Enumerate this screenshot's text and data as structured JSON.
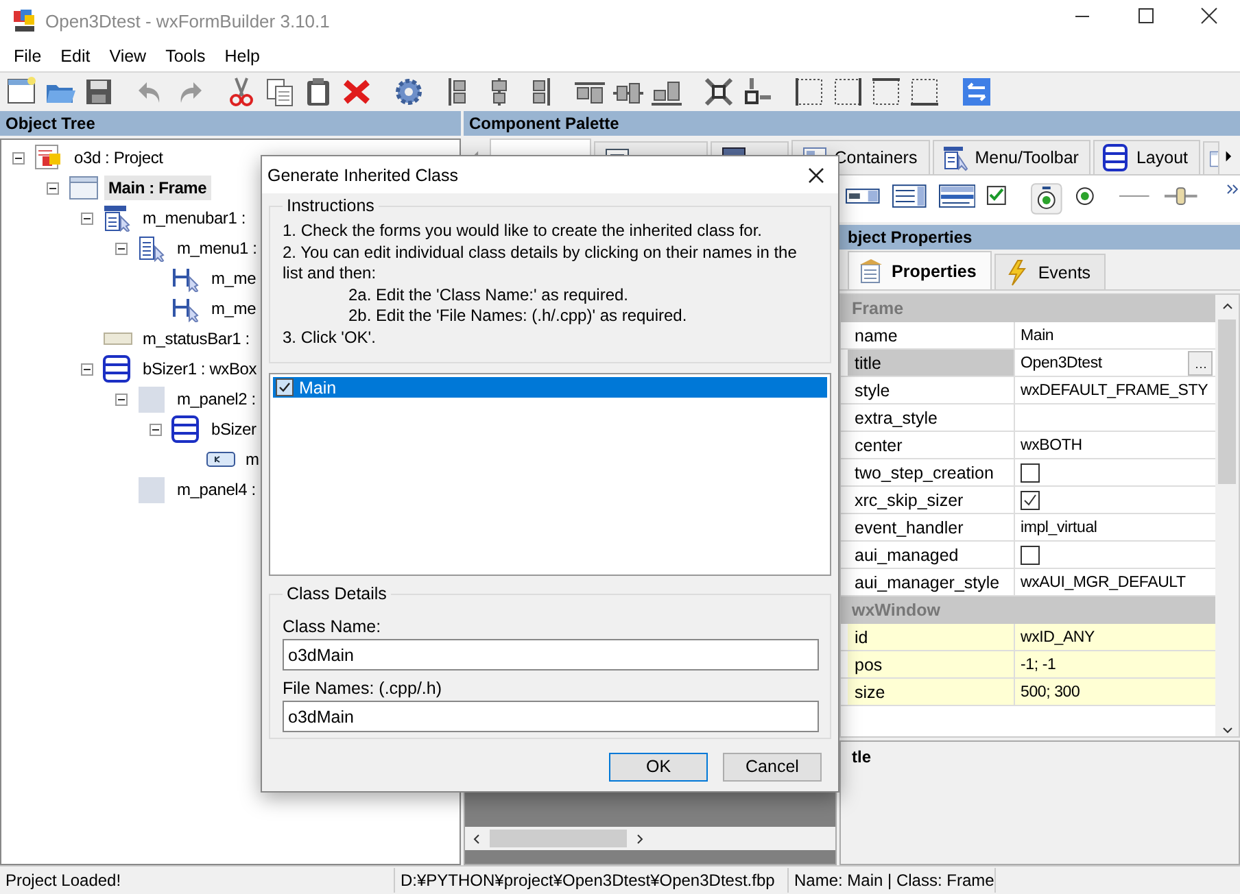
{
  "window": {
    "title": "Open3Dtest - wxFormBuilder 3.10.1"
  },
  "menu": [
    "File",
    "Edit",
    "View",
    "Tools",
    "Help"
  ],
  "object_tree": {
    "title": "Object Tree",
    "items": [
      {
        "label": "o3d : Project",
        "kind": "project",
        "selected": false,
        "expanded": true,
        "children": [
          {
            "label": "Main : Frame",
            "kind": "frame",
            "selected": true,
            "expanded": true,
            "children": [
              {
                "label": "m_menubar1 :",
                "kind": "menubar",
                "selected": false,
                "expanded": true,
                "children": [
                  {
                    "label": "m_menu1 :",
                    "kind": "menu",
                    "selected": false,
                    "expanded": true,
                    "children": [
                      {
                        "label": "m_me",
                        "kind": "menuitem",
                        "selected": false
                      },
                      {
                        "label": "m_me",
                        "kind": "menuitem",
                        "selected": false
                      }
                    ]
                  }
                ]
              },
              {
                "label": "m_statusBar1 :",
                "kind": "statusbar",
                "selected": false
              },
              {
                "label": "bSizer1 : wxBox",
                "kind": "sizer",
                "selected": false,
                "expanded": true,
                "children": [
                  {
                    "label": "m_panel2 :",
                    "kind": "panel",
                    "selected": false,
                    "expanded": true,
                    "children": [
                      {
                        "label": "bSizer",
                        "kind": "sizer",
                        "selected": false,
                        "expanded": true,
                        "children": [
                          {
                            "label": "m",
                            "kind": "button",
                            "selected": false
                          }
                        ]
                      }
                    ]
                  },
                  {
                    "label": "m_panel4 :",
                    "kind": "panel",
                    "selected": false
                  }
                ]
              }
            ]
          }
        ]
      }
    ]
  },
  "palette": {
    "title": "Component Palette",
    "tabs": [
      {
        "kind": "common",
        "selected": true
      },
      {
        "kind": "additional",
        "selected": false
      },
      {
        "kind": "data",
        "selected": false
      },
      {
        "kind": "containers",
        "label": "Containers",
        "selected": false
      },
      {
        "kind": "menu",
        "label": "Menu/Toolbar",
        "selected": false
      },
      {
        "kind": "layout",
        "label": "Layout",
        "selected": false
      },
      {
        "kind": "forms",
        "selected": false
      }
    ]
  },
  "properties": {
    "title": "bject Properties",
    "tabs": [
      {
        "kind": "properties",
        "label": "Properties",
        "selected": true
      },
      {
        "kind": "events",
        "label": "Events",
        "selected": false
      }
    ],
    "categories": [
      {
        "name": "Frame",
        "highlighted": false,
        "rows": [
          {
            "name": "name",
            "kind": "text",
            "value": "Main",
            "selected": false
          },
          {
            "name": "title",
            "kind": "button",
            "value": "Open3Dtest",
            "selected": true
          },
          {
            "name": "style",
            "kind": "text",
            "value": "wxDEFAULT_FRAME_STY",
            "selected": false
          },
          {
            "name": "extra_style",
            "kind": "text",
            "selected": false
          },
          {
            "name": "center",
            "kind": "text",
            "value": "wxBOTH",
            "selected": false
          },
          {
            "name": "two_step_creation",
            "kind": "check",
            "checked": false,
            "selected": false
          },
          {
            "name": "xrc_skip_sizer",
            "kind": "check",
            "checked": true,
            "selected": false
          },
          {
            "name": "event_handler",
            "kind": "text",
            "value": "impl_virtual",
            "selected": false
          },
          {
            "name": "aui_managed",
            "kind": "check",
            "checked": false,
            "selected": false
          },
          {
            "name": "aui_manager_style",
            "kind": "text",
            "value": "wxAUI_MGR_DEFAULT",
            "selected": false
          }
        ]
      },
      {
        "name": "wxWindow",
        "highlighted": true,
        "rows": [
          {
            "name": "id",
            "kind": "text",
            "value": "wxID_ANY",
            "selected": false
          },
          {
            "name": "pos",
            "kind": "text",
            "value": "-1; -1",
            "selected": false
          },
          {
            "name": "size",
            "kind": "text",
            "value": "500; 300",
            "selected": false
          }
        ]
      }
    ],
    "description_title": "tle"
  },
  "dialog": {
    "title": "Generate Inherited Class",
    "instructions": {
      "label": "Instructions",
      "lines": [
        {
          "kind": "step",
          "text": "1. Check the forms you would like to create the inherited class for."
        },
        {
          "kind": "step",
          "text": "2. You can edit individual class details by clicking on their names in the list and then:"
        },
        {
          "kind": "substep",
          "text": "2a. Edit the 'Class Name:' as required."
        },
        {
          "kind": "substep",
          "text": "2b. Edit the 'File Names: (.h/.cpp)' as required."
        },
        {
          "kind": "step",
          "text": "3. Click 'OK'."
        }
      ]
    },
    "forms": [
      {
        "label": "Main",
        "checked": true,
        "selected": true
      }
    ],
    "class_details": {
      "label": "Class Details",
      "fields": [
        {
          "label": "Class Name:",
          "value": "o3dMain"
        },
        {
          "label": "File Names: (.cpp/.h)",
          "value": "o3dMain"
        }
      ]
    },
    "buttons": [
      "OK",
      "Cancel"
    ]
  },
  "status_bar": [
    "Project Loaded!",
    "D:¥PYTHON¥project¥Open3Dtest¥Open3Dtest.fbp",
    "Name: Main | Class: Frame"
  ]
}
